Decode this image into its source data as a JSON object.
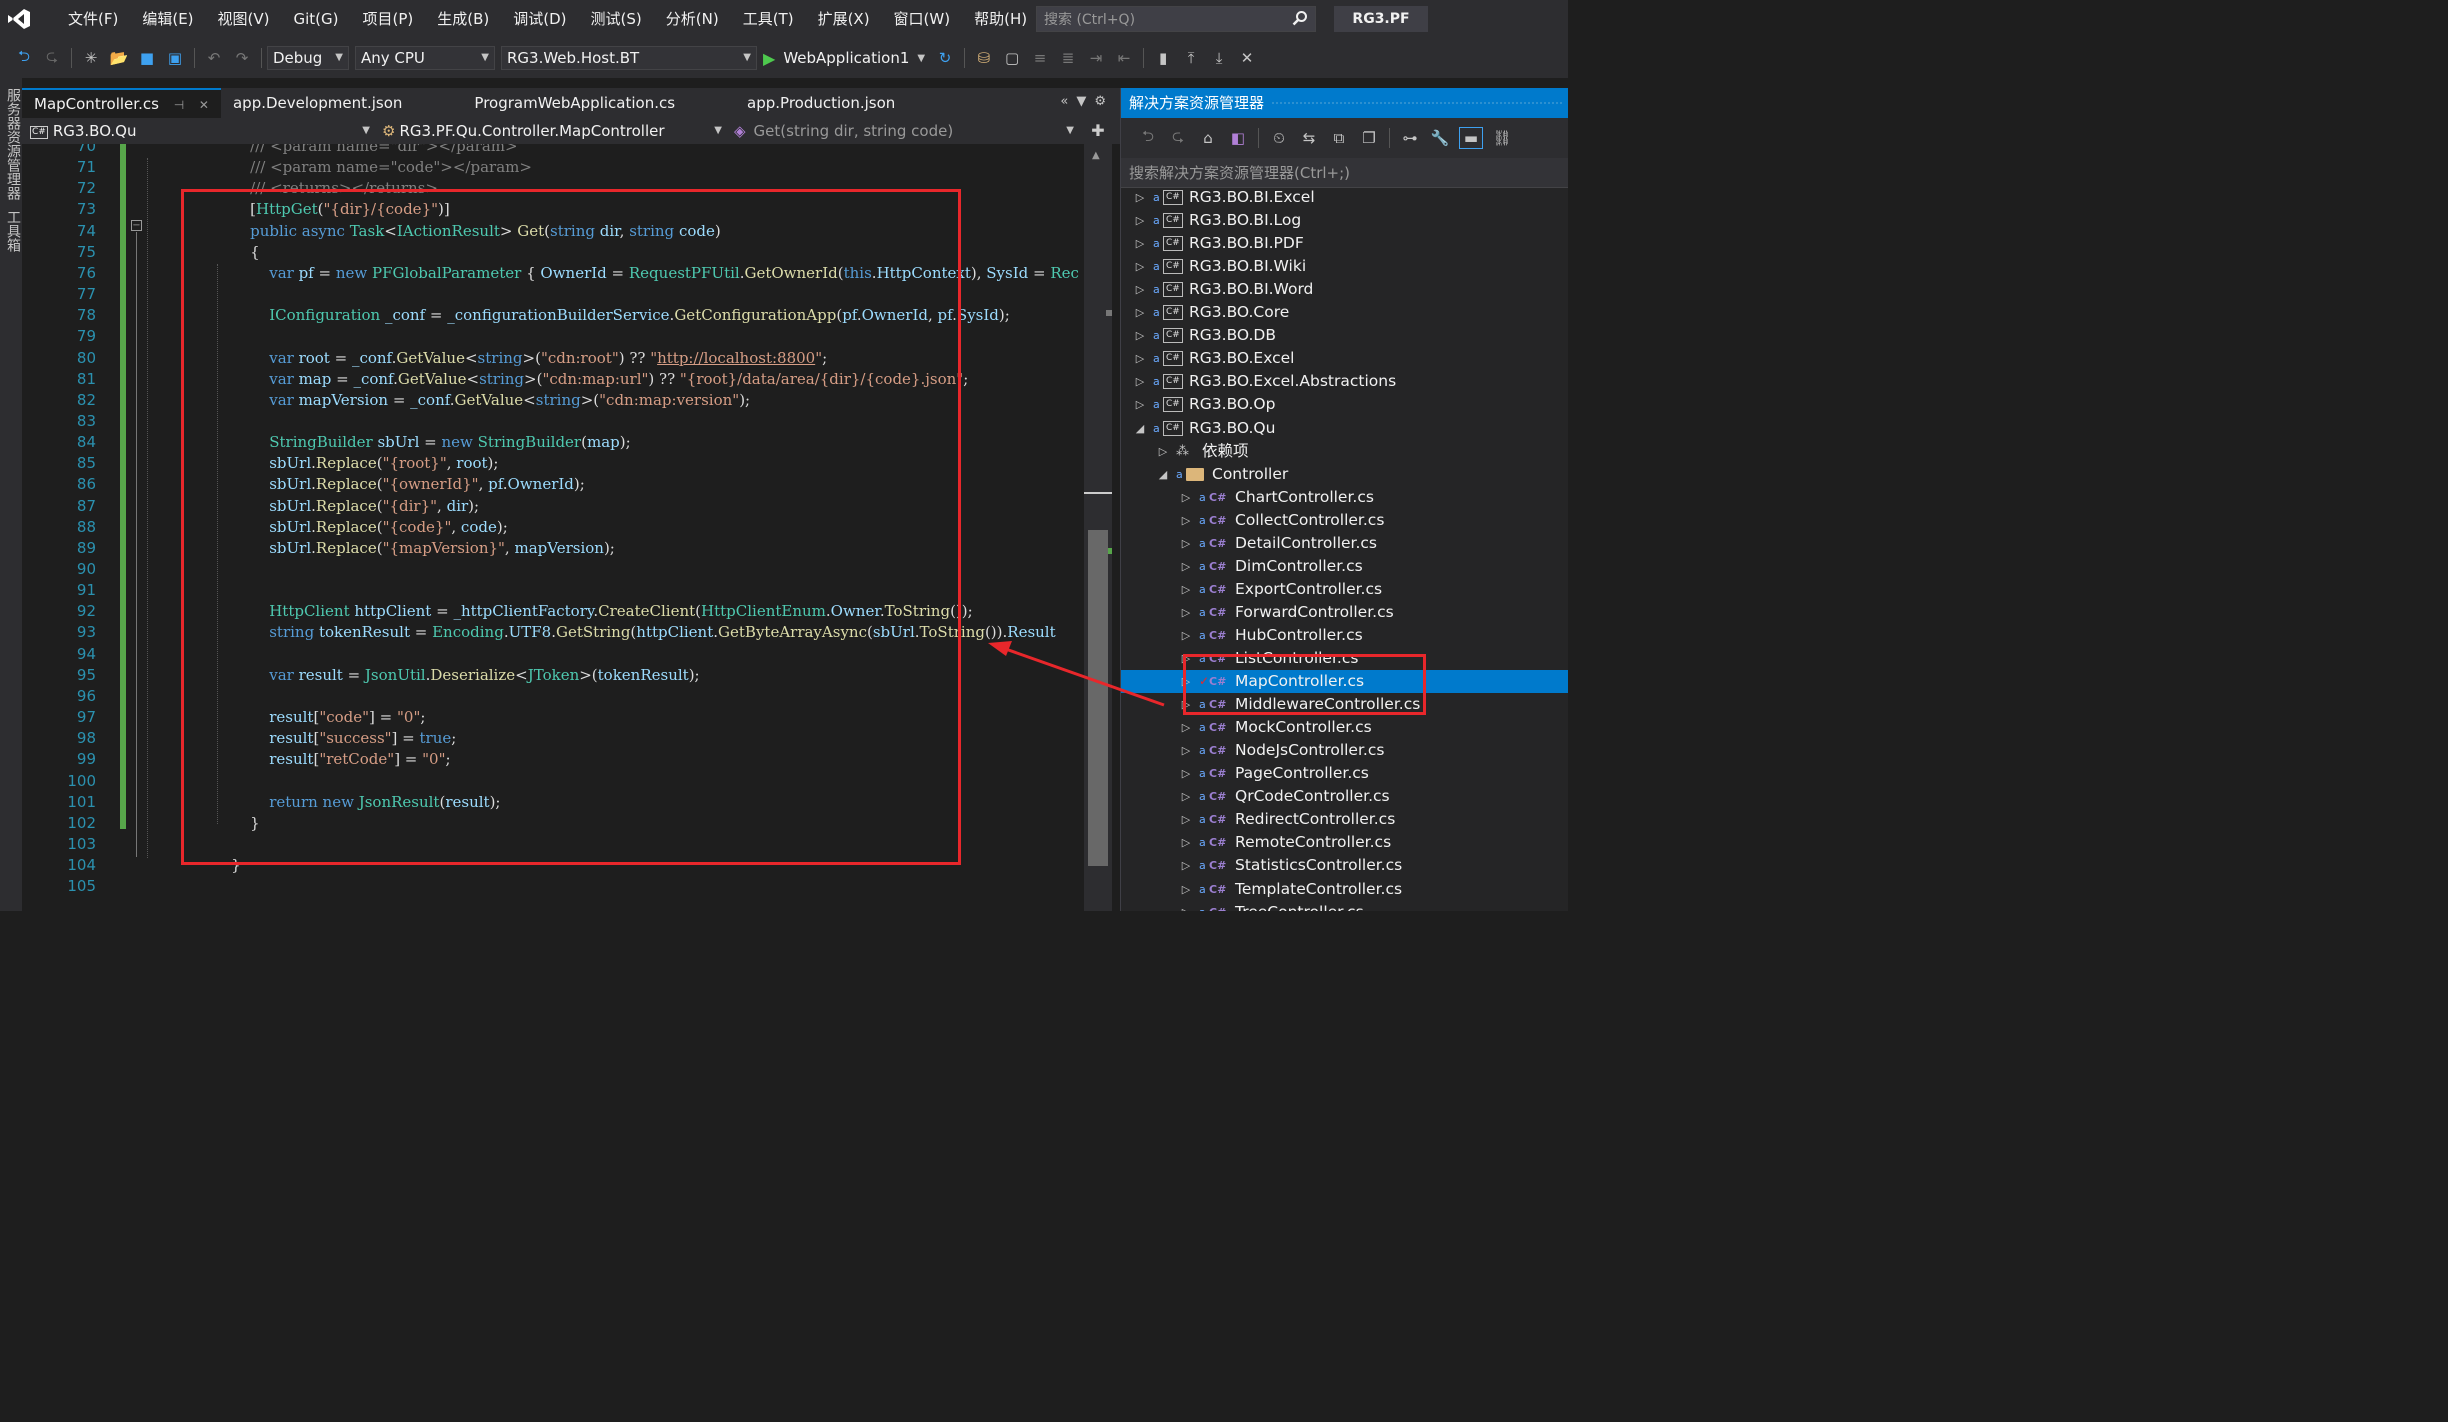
{
  "menu": {
    "items": [
      "文件(F)",
      "编辑(E)",
      "视图(V)",
      "Git(G)",
      "项目(P)",
      "生成(B)",
      "调试(D)",
      "测试(S)",
      "分析(N)",
      "工具(T)",
      "扩展(X)",
      "窗口(W)",
      "帮助(H)"
    ],
    "search_placeholder": "搜索 (Ctrl+Q)",
    "solution_name": "RG3.PF"
  },
  "toolbar": {
    "configuration": "Debug",
    "platform": "Any CPU",
    "startup_project": "RG3.Web.Host.BT",
    "run_target": "WebApplication1"
  },
  "left_strip": {
    "server_explorer": "服务器资源管理器",
    "toolbox": "工具箱"
  },
  "tabs": [
    {
      "label": "MapController.cs",
      "active": true
    },
    {
      "label": "app.Development.json",
      "active": false
    },
    {
      "label": "ProgramWebApplication.cs",
      "active": false
    },
    {
      "label": "app.Production.json",
      "active": false
    }
  ],
  "navbar": {
    "project": "RG3.BO.Qu",
    "type": "RG3.PF.Qu.Controller.MapController",
    "member": "Get(string dir, string code)"
  },
  "editor": {
    "line_numbers": [
      "70",
      "71",
      "72",
      "73",
      "74",
      "75",
      "76",
      "77",
      "78",
      "79",
      "80",
      "81",
      "82",
      "83",
      "84",
      "85",
      "86",
      "87",
      "88",
      "89",
      "90",
      "91",
      "92",
      "93",
      "94",
      "95",
      "96",
      "97",
      "98",
      "99",
      "100",
      "101",
      "102",
      "103",
      "104",
      "105"
    ],
    "lines": [
      [
        [
          "cmg",
          "        /// <param name=\"dir\"></param>"
        ]
      ],
      [
        [
          "cmg",
          "        /// "
        ],
        [
          "cmg",
          "<param name="
        ],
        [
          "cmg",
          "\"code\""
        ],
        [
          "cmg",
          "></param>"
        ]
      ],
      [
        [
          "cmg",
          "        /// <returns></returns>"
        ]
      ],
      [
        [
          "pl",
          "        ["
        ],
        [
          "ty",
          "HttpGet"
        ],
        [
          "pl",
          "("
        ],
        [
          "st",
          "\"{dir}/{code}\""
        ],
        [
          "pl",
          ")]"
        ]
      ],
      [
        [
          "kw",
          "        public async "
        ],
        [
          "ty",
          "Task"
        ],
        [
          "pl",
          "<"
        ],
        [
          "ty",
          "IActionResult"
        ],
        [
          "pl",
          "> "
        ],
        [
          "mt",
          "Get"
        ],
        [
          "pl",
          "("
        ],
        [
          "kw",
          "string "
        ],
        [
          "id",
          "dir"
        ],
        [
          "pl",
          ", "
        ],
        [
          "kw",
          "string "
        ],
        [
          "id",
          "code"
        ],
        [
          "pl",
          ")"
        ]
      ],
      [
        [
          "pl",
          "        {"
        ]
      ],
      [
        [
          "kw",
          "            var "
        ],
        [
          "id",
          "pf"
        ],
        [
          "pl",
          " = "
        ],
        [
          "kw",
          "new "
        ],
        [
          "ty",
          "PFGlobalParameter"
        ],
        [
          "pl",
          " { "
        ],
        [
          "id",
          "OwnerId"
        ],
        [
          "pl",
          " = "
        ],
        [
          "ty",
          "RequestPFUtil"
        ],
        [
          "pl",
          "."
        ],
        [
          "mt",
          "GetOwnerId"
        ],
        [
          "pl",
          "("
        ],
        [
          "kw",
          "this"
        ],
        [
          "pl",
          "."
        ],
        [
          "id",
          "HttpContext"
        ],
        [
          "pl",
          "), "
        ],
        [
          "id",
          "SysId"
        ],
        [
          "pl",
          " = "
        ],
        [
          "ty",
          "Rec"
        ]
      ],
      [
        [
          "pl",
          ""
        ]
      ],
      [
        [
          "ty",
          "            IConfiguration "
        ],
        [
          "id",
          "_conf"
        ],
        [
          "pl",
          " = "
        ],
        [
          "id",
          "_configurationBuilderService"
        ],
        [
          "pl",
          "."
        ],
        [
          "mt",
          "GetConfigurationApp"
        ],
        [
          "pl",
          "("
        ],
        [
          "id",
          "pf"
        ],
        [
          "pl",
          "."
        ],
        [
          "id",
          "OwnerId"
        ],
        [
          "pl",
          ", "
        ],
        [
          "id",
          "pf"
        ],
        [
          "pl",
          "."
        ],
        [
          "id",
          "SysId"
        ],
        [
          "pl",
          ");"
        ]
      ],
      [
        [
          "pl",
          ""
        ]
      ],
      [
        [
          "kw",
          "            var "
        ],
        [
          "id",
          "root"
        ],
        [
          "pl",
          " = "
        ],
        [
          "id",
          "_conf"
        ],
        [
          "pl",
          "."
        ],
        [
          "mt",
          "GetValue"
        ],
        [
          "pl",
          "<"
        ],
        [
          "kw",
          "string"
        ],
        [
          "pl",
          ">("
        ],
        [
          "st",
          "\"cdn:root\""
        ],
        [
          "pl",
          ") ?? "
        ],
        [
          "st",
          "\""
        ],
        [
          "url",
          "http://localhost:8800"
        ],
        [
          "st",
          "\""
        ],
        [
          "pl",
          ";"
        ]
      ],
      [
        [
          "kw",
          "            var "
        ],
        [
          "id",
          "map"
        ],
        [
          "pl",
          " = "
        ],
        [
          "id",
          "_conf"
        ],
        [
          "pl",
          "."
        ],
        [
          "mt",
          "GetValue"
        ],
        [
          "pl",
          "<"
        ],
        [
          "kw",
          "string"
        ],
        [
          "pl",
          ">("
        ],
        [
          "st",
          "\"cdn:map:url\""
        ],
        [
          "pl",
          ") ?? "
        ],
        [
          "st",
          "\"{root}/data/area/{dir}/{code}.json\""
        ],
        [
          "pl",
          ";"
        ]
      ],
      [
        [
          "kw",
          "            var "
        ],
        [
          "id",
          "mapVersion"
        ],
        [
          "pl",
          " = "
        ],
        [
          "id",
          "_conf"
        ],
        [
          "pl",
          "."
        ],
        [
          "mt",
          "GetValue"
        ],
        [
          "pl",
          "<"
        ],
        [
          "kw",
          "string"
        ],
        [
          "pl",
          ">("
        ],
        [
          "st",
          "\"cdn:map:version\""
        ],
        [
          "pl",
          ");"
        ]
      ],
      [
        [
          "pl",
          ""
        ]
      ],
      [
        [
          "ty",
          "            StringBuilder "
        ],
        [
          "id",
          "sbUrl"
        ],
        [
          "pl",
          " = "
        ],
        [
          "kw",
          "new "
        ],
        [
          "ty",
          "StringBuilder"
        ],
        [
          "pl",
          "("
        ],
        [
          "id",
          "map"
        ],
        [
          "pl",
          ");"
        ]
      ],
      [
        [
          "id",
          "            sbUrl"
        ],
        [
          "pl",
          "."
        ],
        [
          "mt",
          "Replace"
        ],
        [
          "pl",
          "("
        ],
        [
          "st",
          "\"{root}\""
        ],
        [
          "pl",
          ", "
        ],
        [
          "id",
          "root"
        ],
        [
          "pl",
          ");"
        ]
      ],
      [
        [
          "id",
          "            sbUrl"
        ],
        [
          "pl",
          "."
        ],
        [
          "mt",
          "Replace"
        ],
        [
          "pl",
          "("
        ],
        [
          "st",
          "\"{ownerId}\""
        ],
        [
          "pl",
          ", "
        ],
        [
          "id",
          "pf"
        ],
        [
          "pl",
          "."
        ],
        [
          "id",
          "OwnerId"
        ],
        [
          "pl",
          ");"
        ]
      ],
      [
        [
          "id",
          "            sbUrl"
        ],
        [
          "pl",
          "."
        ],
        [
          "mt",
          "Replace"
        ],
        [
          "pl",
          "("
        ],
        [
          "st",
          "\"{dir}\""
        ],
        [
          "pl",
          ", "
        ],
        [
          "id",
          "dir"
        ],
        [
          "pl",
          ");"
        ]
      ],
      [
        [
          "id",
          "            sbUrl"
        ],
        [
          "pl",
          "."
        ],
        [
          "mt",
          "Replace"
        ],
        [
          "pl",
          "("
        ],
        [
          "st",
          "\"{code}\""
        ],
        [
          "pl",
          ", "
        ],
        [
          "id",
          "code"
        ],
        [
          "pl",
          ");"
        ]
      ],
      [
        [
          "id",
          "            sbUrl"
        ],
        [
          "pl",
          "."
        ],
        [
          "mt",
          "Replace"
        ],
        [
          "pl",
          "("
        ],
        [
          "st",
          "\"{mapVersion}\""
        ],
        [
          "pl",
          ", "
        ],
        [
          "id",
          "mapVersion"
        ],
        [
          "pl",
          ");"
        ]
      ],
      [
        [
          "pl",
          ""
        ]
      ],
      [
        [
          "pl",
          ""
        ]
      ],
      [
        [
          "ty",
          "            HttpClient "
        ],
        [
          "id",
          "httpClient"
        ],
        [
          "pl",
          " = "
        ],
        [
          "id",
          "_httpClientFactory"
        ],
        [
          "pl",
          "."
        ],
        [
          "mt",
          "CreateClient"
        ],
        [
          "pl",
          "("
        ],
        [
          "ty",
          "HttpClientEnum"
        ],
        [
          "pl",
          "."
        ],
        [
          "id",
          "Owner"
        ],
        [
          "pl",
          "."
        ],
        [
          "mt",
          "ToString"
        ],
        [
          "pl",
          "());"
        ]
      ],
      [
        [
          "kw",
          "            string "
        ],
        [
          "id",
          "tokenResult"
        ],
        [
          "pl",
          " = "
        ],
        [
          "ty",
          "Encoding"
        ],
        [
          "pl",
          "."
        ],
        [
          "id",
          "UTF8"
        ],
        [
          "pl",
          "."
        ],
        [
          "mt",
          "GetString"
        ],
        [
          "pl",
          "("
        ],
        [
          "id",
          "httpClient"
        ],
        [
          "pl",
          "."
        ],
        [
          "mt",
          "GetByteArrayAsync"
        ],
        [
          "pl",
          "("
        ],
        [
          "id",
          "sbUrl"
        ],
        [
          "pl",
          "."
        ],
        [
          "mt",
          "ToString"
        ],
        [
          "pl",
          "())."
        ],
        [
          "id",
          "Result"
        ]
      ],
      [
        [
          "pl",
          ""
        ]
      ],
      [
        [
          "kw",
          "            var "
        ],
        [
          "id",
          "result"
        ],
        [
          "pl",
          " = "
        ],
        [
          "ty",
          "JsonUtil"
        ],
        [
          "pl",
          "."
        ],
        [
          "mt",
          "Deserialize"
        ],
        [
          "pl",
          "<"
        ],
        [
          "ty",
          "JToken"
        ],
        [
          "pl",
          ">("
        ],
        [
          "id",
          "tokenResult"
        ],
        [
          "pl",
          ");"
        ]
      ],
      [
        [
          "pl",
          ""
        ]
      ],
      [
        [
          "id",
          "            result"
        ],
        [
          "pl",
          "["
        ],
        [
          "st",
          "\"code\""
        ],
        [
          "pl",
          "] = "
        ],
        [
          "st",
          "\"0\""
        ],
        [
          "pl",
          ";"
        ]
      ],
      [
        [
          "id",
          "            result"
        ],
        [
          "pl",
          "["
        ],
        [
          "st",
          "\"success\""
        ],
        [
          "pl",
          "] = "
        ],
        [
          "kw",
          "true"
        ],
        [
          "pl",
          ";"
        ]
      ],
      [
        [
          "id",
          "            result"
        ],
        [
          "pl",
          "["
        ],
        [
          "st",
          "\"retCode\""
        ],
        [
          "pl",
          "] = "
        ],
        [
          "st",
          "\"0\""
        ],
        [
          "pl",
          ";"
        ]
      ],
      [
        [
          "pl",
          ""
        ]
      ],
      [
        [
          "kw",
          "            return new "
        ],
        [
          "ty",
          "JsonResult"
        ],
        [
          "pl",
          "("
        ],
        [
          "id",
          "result"
        ],
        [
          "pl",
          ");"
        ]
      ],
      [
        [
          "pl",
          "        }"
        ]
      ],
      [
        [
          "pl",
          ""
        ]
      ],
      [
        [
          "pl",
          "    }"
        ]
      ],
      [
        [
          "pl",
          ""
        ]
      ]
    ]
  },
  "solution_explorer": {
    "title": "解决方案资源管理器",
    "search_placeholder": "搜索解决方案资源管理器(Ctrl+;)",
    "items": [
      {
        "label": "RG3.BO.BI.Excel",
        "kind": "project",
        "level": 0,
        "expanded": false
      },
      {
        "label": "RG3.BO.BI.Log",
        "kind": "project",
        "level": 0,
        "expanded": false
      },
      {
        "label": "RG3.BO.BI.PDF",
        "kind": "project",
        "level": 0,
        "expanded": false
      },
      {
        "label": "RG3.BO.BI.Wiki",
        "kind": "project",
        "level": 0,
        "expanded": false
      },
      {
        "label": "RG3.BO.BI.Word",
        "kind": "project",
        "level": 0,
        "expanded": false
      },
      {
        "label": "RG3.BO.Core",
        "kind": "project",
        "level": 0,
        "expanded": false
      },
      {
        "label": "RG3.BO.DB",
        "kind": "project",
        "level": 0,
        "expanded": false
      },
      {
        "label": "RG3.BO.Excel",
        "kind": "project",
        "level": 0,
        "expanded": false
      },
      {
        "label": "RG3.BO.Excel.Abstractions",
        "kind": "project",
        "level": 0,
        "expanded": false
      },
      {
        "label": "RG3.BO.Op",
        "kind": "project",
        "level": 0,
        "expanded": false
      },
      {
        "label": "RG3.BO.Qu",
        "kind": "project",
        "level": 0,
        "expanded": true
      },
      {
        "label": "依赖项",
        "kind": "dependency",
        "level": 1,
        "expanded": false
      },
      {
        "label": "Controller",
        "kind": "folder",
        "level": 1,
        "expanded": true
      },
      {
        "label": "ChartController.cs",
        "kind": "file",
        "level": 2
      },
      {
        "label": "CollectController.cs",
        "kind": "file",
        "level": 2
      },
      {
        "label": "DetailController.cs",
        "kind": "file",
        "level": 2
      },
      {
        "label": "DimController.cs",
        "kind": "file",
        "level": 2
      },
      {
        "label": "ExportController.cs",
        "kind": "file",
        "level": 2
      },
      {
        "label": "ForwardController.cs",
        "kind": "file",
        "level": 2
      },
      {
        "label": "HubController.cs",
        "kind": "file",
        "level": 2
      },
      {
        "label": "ListController.cs",
        "kind": "file",
        "level": 2
      },
      {
        "label": "MapController.cs",
        "kind": "file",
        "level": 2,
        "selected": true,
        "modified": true
      },
      {
        "label": "MiddlewareController.cs",
        "kind": "file",
        "level": 2
      },
      {
        "label": "MockController.cs",
        "kind": "file",
        "level": 2
      },
      {
        "label": "NodeJsController.cs",
        "kind": "file",
        "level": 2
      },
      {
        "label": "PageController.cs",
        "kind": "file",
        "level": 2
      },
      {
        "label": "QrCodeController.cs",
        "kind": "file",
        "level": 2
      },
      {
        "label": "RedirectController.cs",
        "kind": "file",
        "level": 2
      },
      {
        "label": "RemoteController.cs",
        "kind": "file",
        "level": 2
      },
      {
        "label": "StatisticsController.cs",
        "kind": "file",
        "level": 2
      },
      {
        "label": "TemplateController.cs",
        "kind": "file",
        "level": 2
      },
      {
        "label": "TreeController.cs",
        "kind": "file",
        "level": 2
      }
    ]
  },
  "colors": {
    "accent": "#007acc",
    "annotation": "#e8272b",
    "editor_bg": "#1e1e1e",
    "chrome_bg": "#2d2d30"
  }
}
